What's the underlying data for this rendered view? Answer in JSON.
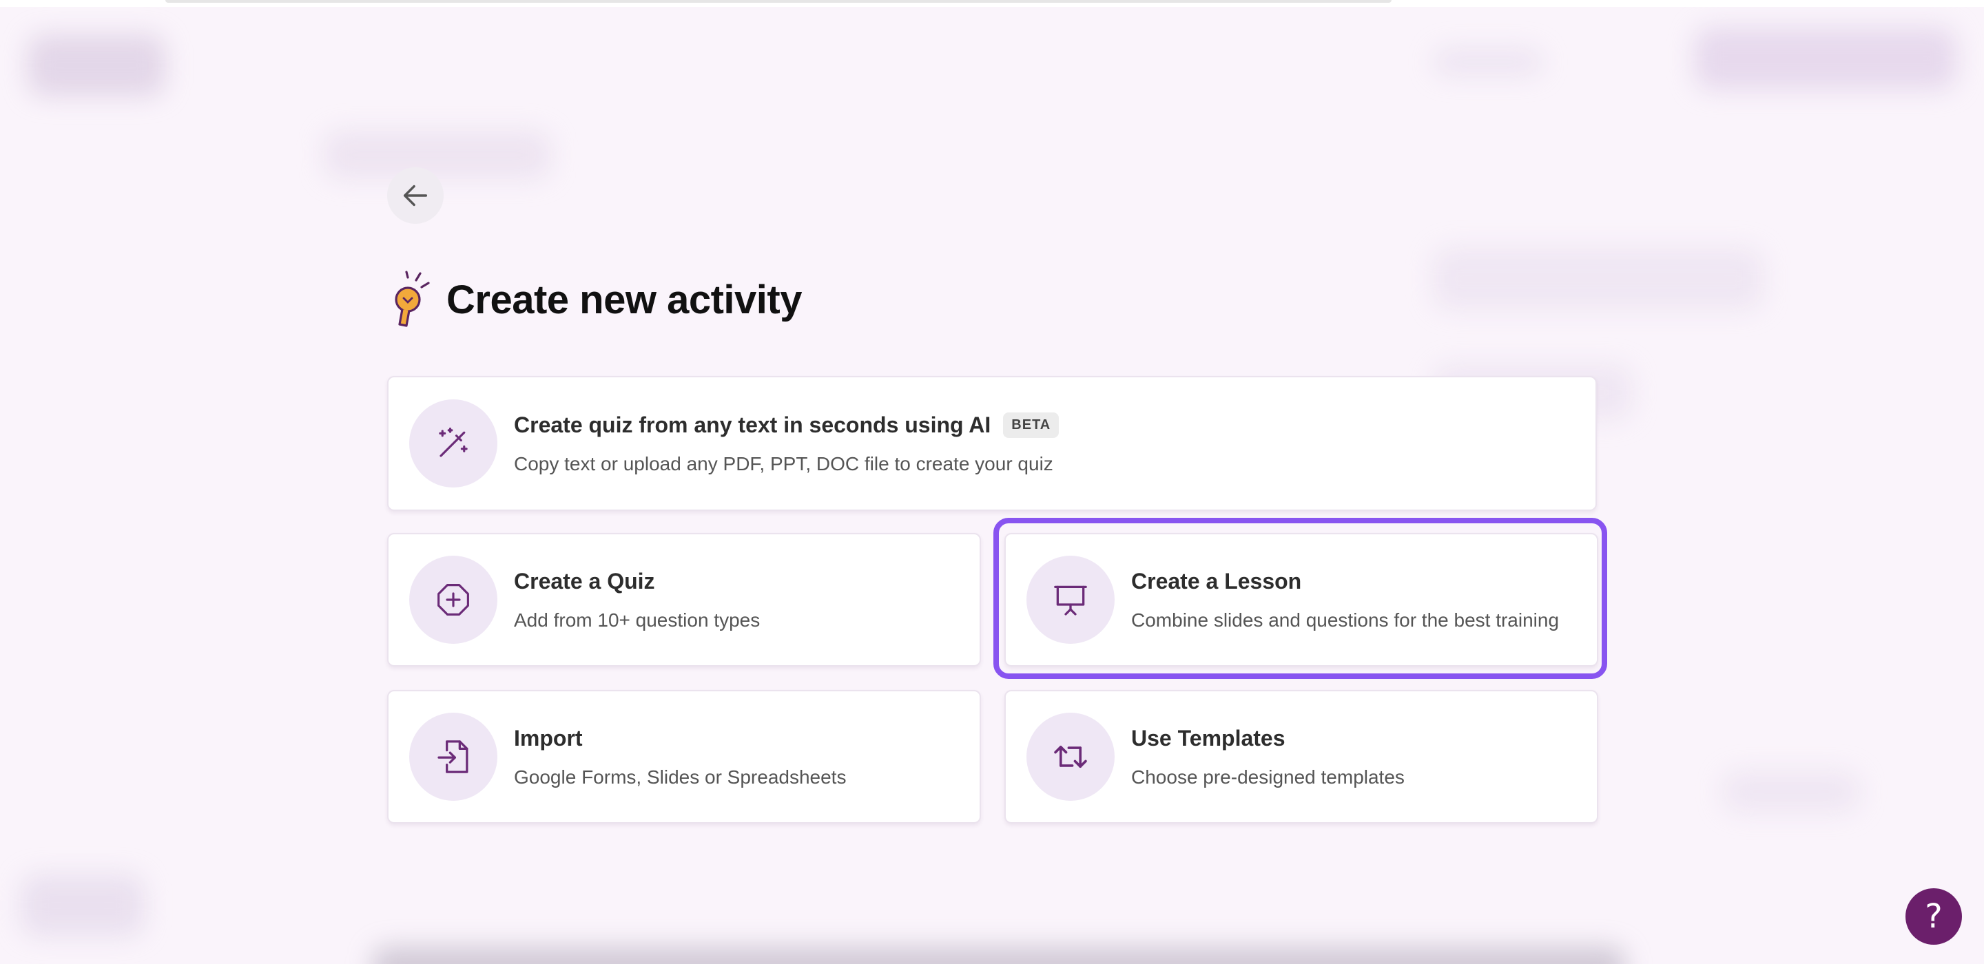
{
  "header": {
    "back_icon": "arrow-left-icon",
    "title_icon": "lightbulb-icon",
    "title": "Create new activity"
  },
  "options": {
    "ai_quiz": {
      "icon": "magic-wand-icon",
      "title": "Create quiz from any text in seconds using AI",
      "badge": "BETA",
      "description": "Copy text or upload any PDF, PPT, DOC file to create your quiz"
    },
    "quiz": {
      "icon": "plus-octagon-icon",
      "title": "Create a Quiz",
      "description": "Add from 10+ question types"
    },
    "lesson": {
      "icon": "presentation-icon",
      "title": "Create a Lesson",
      "description": "Combine slides and questions for the best training",
      "highlighted": true
    },
    "import": {
      "icon": "file-import-icon",
      "title": "Import",
      "description": "Google Forms, Slides or Spreadsheets"
    },
    "templates": {
      "icon": "swap-arrows-icon",
      "title": "Use Templates",
      "description": "Choose pre-designed templates"
    }
  },
  "help": {
    "icon": "question-mark-icon",
    "label": "?"
  },
  "colors": {
    "background": "#faf4fb",
    "accent": "#8854f0",
    "icon_purple": "#6b2b78",
    "icon_circle": "#efe7f5",
    "help_button": "#6b1f6b"
  }
}
